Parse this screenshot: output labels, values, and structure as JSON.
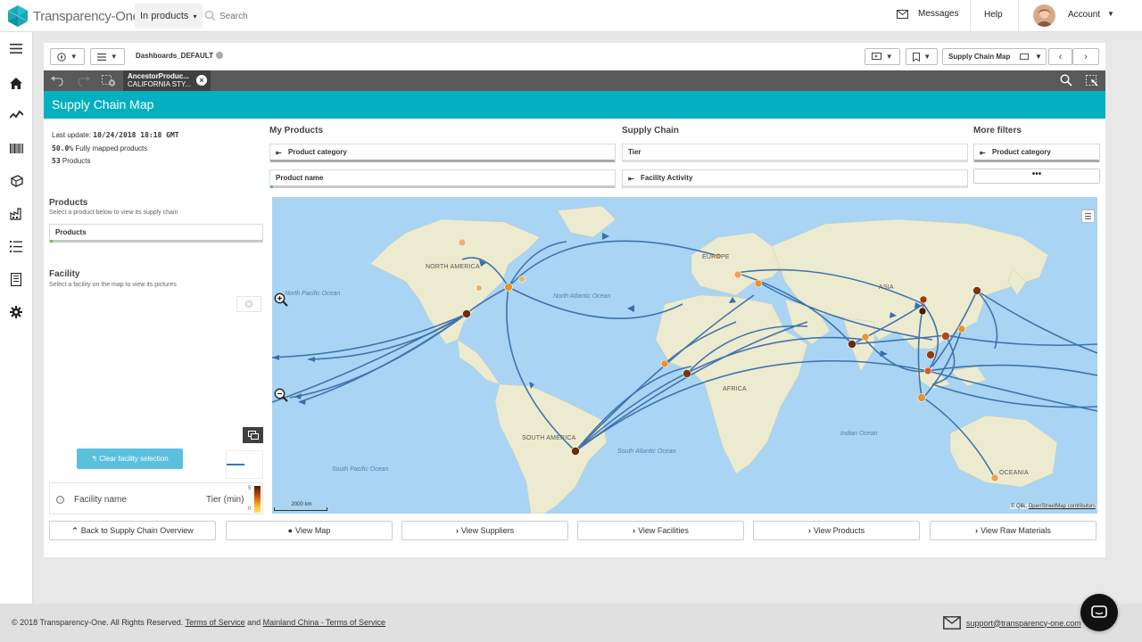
{
  "header": {
    "brand": "Transparency-One",
    "product_menu": "In products",
    "search_placeholder": "Search",
    "messages": "Messages",
    "help": "Help",
    "account": "Account"
  },
  "toolbar": {
    "dashboard_name": "Dashboards_DEFAULT",
    "sheet_selector": "Supply Chain Map",
    "selection_field": "AncestorProduc...",
    "selection_value": "CALIFORNIA STY..."
  },
  "sheet": {
    "title": "Supply Chain Map",
    "last_update_label": "Last update:",
    "last_update_value": "10/24/2018 18:18 GMT",
    "mapped_value": "50.0%",
    "mapped_label": "Fully mapped products",
    "products_count": "53",
    "products_label": "Products"
  },
  "products_section": {
    "title": "Products",
    "subtitle": "Select a product below to view its supply chain",
    "listbox": "Products"
  },
  "facility_section": {
    "title": "Facility",
    "subtitle": "Select a facility on the map to view its pictures",
    "clear_button": "Clear facility selection",
    "col_name": "Facility name",
    "col_tier": "Tier (min)",
    "scale_max": "5",
    "scale_min": "0"
  },
  "filters": {
    "my_products_title": "My Products",
    "product_category": "Product category",
    "product_name": "Product name",
    "supply_chain_title": "Supply Chain",
    "tier": "Tier",
    "facility_activity": "Facility Activity",
    "more_filters_title": "More filters",
    "more_product_category": "Product category",
    "more_button": "•••"
  },
  "map": {
    "labels": {
      "north_america": "NORTH AMERICA",
      "europe": "EUROPE",
      "asia": "ASIA",
      "africa": "AFRICA",
      "south_america": "SOUTH AMERICA",
      "oceania": "OCEANIA"
    },
    "oceans": {
      "north_pacific": "North Pacific Ocean",
      "north_atlantic": "North Atlantic Ocean",
      "south_atlantic": "South Atlantic Ocean",
      "south_pacific": "South Pacific Ocean",
      "indian": "Indian Ocean"
    },
    "scale": "2000 km",
    "attribution_1": "© Qlik,",
    "attribution_2": "OpenStreetMap contributors",
    "colors": {
      "route": "#3a6fa8",
      "land": "#ecebd0",
      "water": "#a9d4f3"
    }
  },
  "nav_buttons": [
    {
      "icon": "chevron-up-icon",
      "label": "Back to Supply Chain Overview"
    },
    {
      "icon": "globe-icon",
      "label": "View Map"
    },
    {
      "icon": "chevron-right-icon",
      "label": "View Suppliers"
    },
    {
      "icon": "chevron-right-icon",
      "label": "View Facilities"
    },
    {
      "icon": "chevron-right-icon",
      "label": "View Products"
    },
    {
      "icon": "chevron-right-icon",
      "label": "View Raw Materials"
    }
  ],
  "footer": {
    "copyright": "© 2018 Transparency-One. All Rights Reserved.",
    "terms": "Terms of Service",
    "and": "and",
    "china_terms": "Mainland China - Terms of Service",
    "support_email": "support@transparency-one.com"
  }
}
